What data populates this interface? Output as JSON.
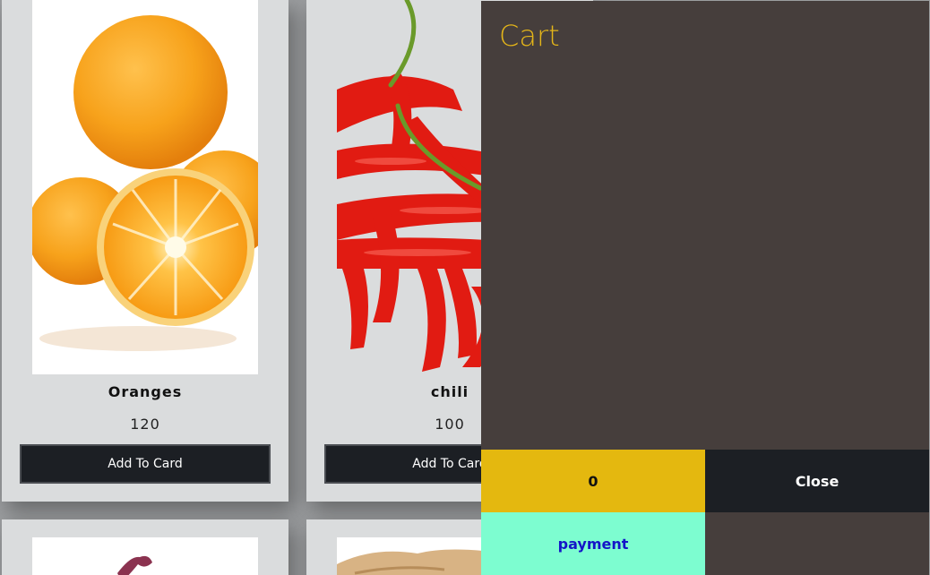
{
  "products": [
    {
      "name": "Oranges",
      "price": "120",
      "button": "Add To Card",
      "image_icon": "oranges-image"
    },
    {
      "name": "chili",
      "price": "100",
      "button": "Add To Card",
      "image_icon": "chili-image"
    }
  ],
  "cart": {
    "title": "Cart",
    "count": "0",
    "close_label": "Close",
    "payment_label": "payment"
  },
  "colors": {
    "cart_bg": "#463e3c",
    "cart_title": "#e4b519",
    "count_bg": "#e4b80f",
    "close_bg": "#1c1f24",
    "payment_bg": "#7dfdd0",
    "payment_text": "#1414c8",
    "card_bg": "#dadcdd"
  }
}
